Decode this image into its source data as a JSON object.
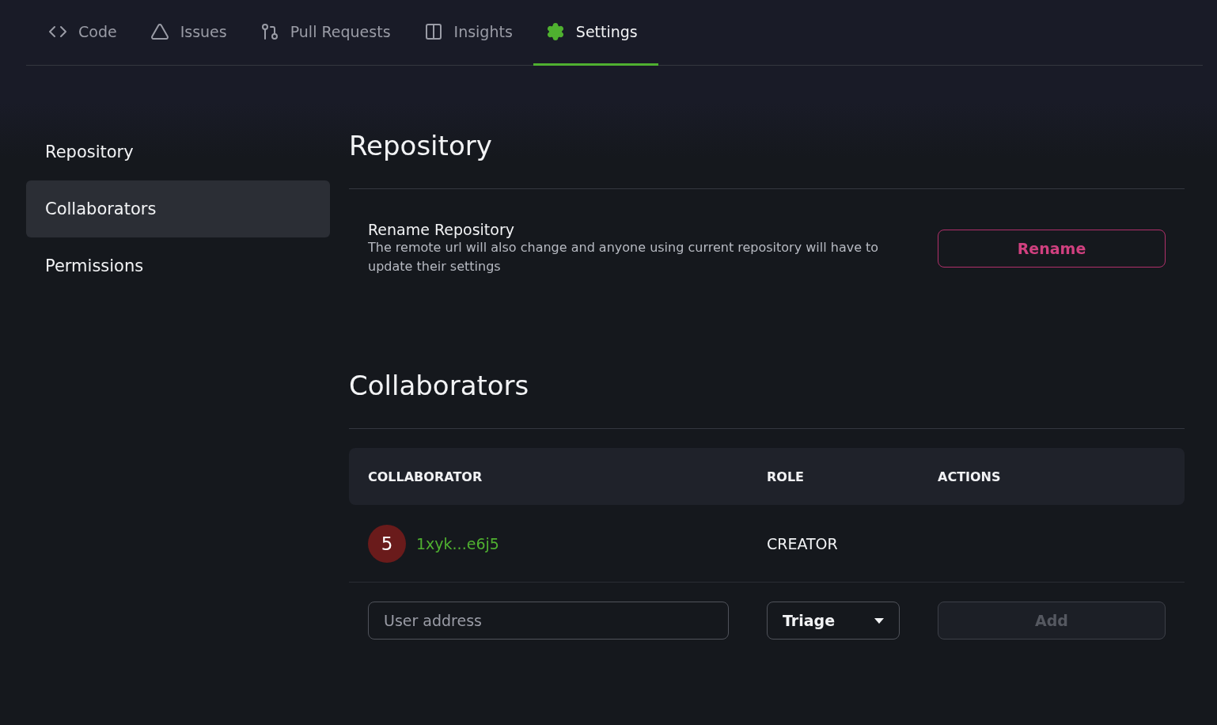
{
  "tabs": [
    {
      "label": "Code",
      "kind": "code",
      "selected": false
    },
    {
      "label": "Issues",
      "kind": "issues",
      "selected": false
    },
    {
      "label": "Pull Requests",
      "kind": "pulls",
      "selected": false
    },
    {
      "label": "Insights",
      "kind": "insights",
      "selected": false
    },
    {
      "label": "Settings",
      "kind": "settings",
      "selected": true
    }
  ],
  "sidebar": {
    "items": [
      {
        "label": "Repository",
        "selected": false
      },
      {
        "label": "Collaborators",
        "selected": true
      },
      {
        "label": "Permissions",
        "selected": false
      }
    ]
  },
  "repository": {
    "title": "Repository",
    "rename": {
      "title": "Rename Repository",
      "description": "The remote url will also change and anyone using current repository will have to update their settings",
      "button": "Rename"
    }
  },
  "collaborators": {
    "title": "Collaborators",
    "columns": [
      "COLLABORATOR",
      "ROLE",
      "ACTIONS"
    ],
    "rows": [
      {
        "avatar": "5",
        "address": "1xyk...e6j5",
        "role": "CREATOR"
      }
    ],
    "add_form": {
      "placeholder": "User address",
      "role": "Triage",
      "button": "Add",
      "disabled": true
    }
  }
}
